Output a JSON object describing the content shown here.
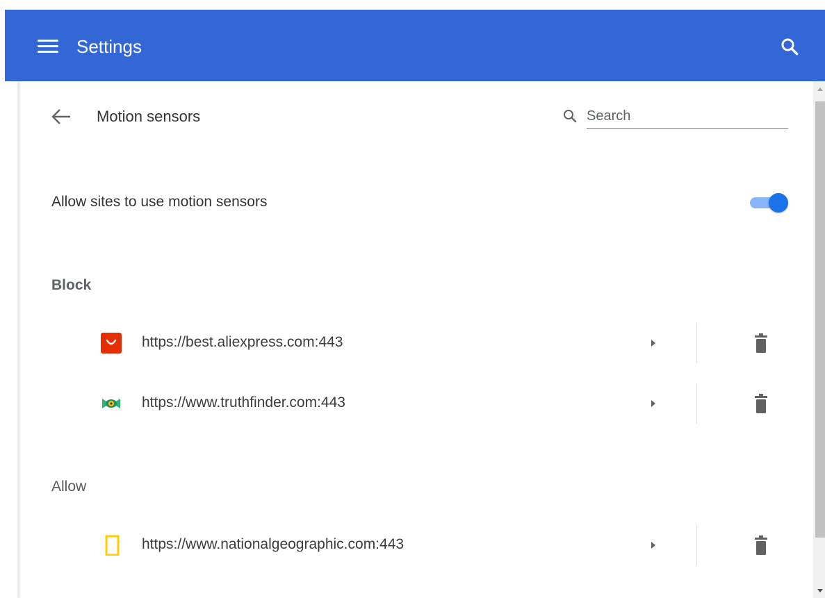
{
  "topbar": {
    "title": "Settings",
    "menu_icon": "hamburger-menu-icon",
    "search_icon": "search-icon",
    "background_color": "#3367d6"
  },
  "page": {
    "title": "Motion sensors",
    "back_icon": "back-arrow-icon",
    "search": {
      "placeholder": "Search",
      "value": ""
    }
  },
  "allow_setting": {
    "label": "Allow sites to use motion sensors",
    "enabled": true,
    "accent_color": "#1a73e8"
  },
  "sections": {
    "block": {
      "heading": "Block",
      "sites": [
        {
          "url": "https://best.aliexpress.com:443",
          "favicon": "aliexpress-favicon",
          "color": "#e62e04"
        },
        {
          "url": "https://www.truthfinder.com:443",
          "favicon": "truthfinder-favicon",
          "color": "#2fb37a"
        }
      ]
    },
    "allow": {
      "heading": "Allow",
      "sites": [
        {
          "url": "https://www.nationalgeographic.com:443",
          "favicon": "nationalgeographic-favicon",
          "color": "#ffce00"
        }
      ]
    }
  },
  "row_icons": {
    "expand": "chevron-right-icon",
    "delete": "trash-icon"
  }
}
